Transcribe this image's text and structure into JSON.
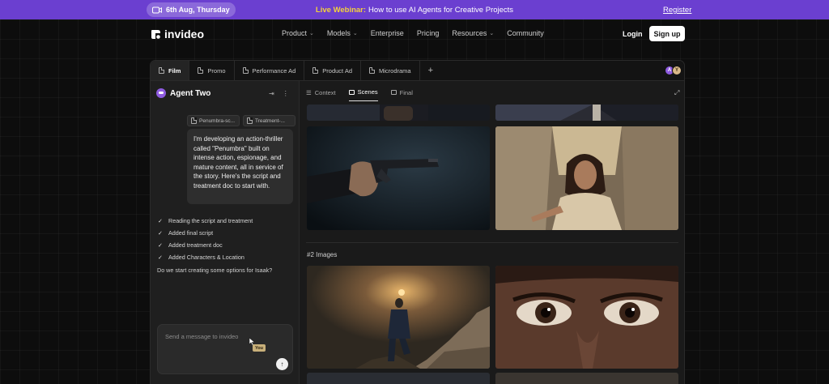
{
  "banner": {
    "date": "6th Aug, Thursday",
    "highlight": "Live Webinar:",
    "message": "How to use AI Agents for Creative Projects",
    "register": "Register",
    "colors": {
      "background": "#6b3fd0",
      "highlight": "#f4d13c"
    }
  },
  "header": {
    "logo_text": "invideo",
    "nav": [
      {
        "label": "Product",
        "dropdown": true
      },
      {
        "label": "Models",
        "dropdown": true
      },
      {
        "label": "Enterprise",
        "dropdown": false
      },
      {
        "label": "Pricing",
        "dropdown": false
      },
      {
        "label": "Resources",
        "dropdown": true
      },
      {
        "label": "Community",
        "dropdown": false
      }
    ],
    "login": "Login",
    "signup": "Sign up"
  },
  "workspace": {
    "tabs": [
      {
        "label": "Film",
        "active": true
      },
      {
        "label": "Promo"
      },
      {
        "label": "Performance Ad"
      },
      {
        "label": "Product Ad"
      },
      {
        "label": "Microdrama"
      }
    ],
    "add_tab_icon": "plus-icon",
    "collaborators": [
      "A",
      "Y"
    ]
  },
  "agent": {
    "title": "Agent Two",
    "attachments": [
      "Penumbra-sc...",
      "Treatment-..."
    ],
    "user_message": "I'm developing an action-thriller called \"Penumbra\" built on intense action, espionage, and mature content, all in service of the story. Here's the script and treatment doc to start with.",
    "steps": [
      "Reading the script and treatment",
      "Added final script",
      "Added treatment doc",
      "Added Characters & Location"
    ],
    "question": "Do we start creating some options for Isaak?",
    "composer_placeholder": "Send a message to invideo",
    "cursor_tag": "You"
  },
  "canvas": {
    "tabs": [
      {
        "label": "Context"
      },
      {
        "label": "Scenes",
        "active": true
      },
      {
        "label": "Final"
      }
    ],
    "section": "#2  Images"
  }
}
